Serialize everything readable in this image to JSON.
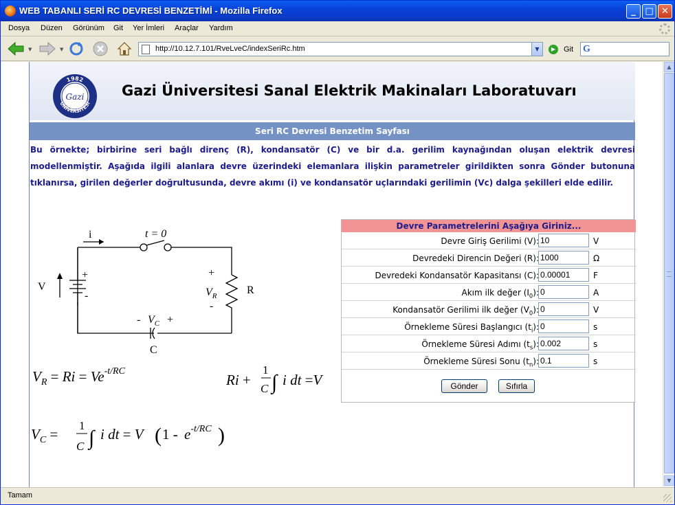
{
  "window": {
    "title": "WEB TABANLI SERİ RC DEVRESİ BENZETİMİ  -  Mozilla Firefox",
    "minimize": "_",
    "maximize": "□",
    "close": "✕"
  },
  "menu": [
    "Dosya",
    "Düzen",
    "Görünüm",
    "Git",
    "Yer İmleri",
    "Araçlar",
    "Yardım"
  ],
  "nav": {
    "url": "http://10.12.7.101/RveLveC/indexSeriRc.htm",
    "go_label": "Git",
    "search_engine": "G"
  },
  "status": {
    "text": "Tamam"
  },
  "page": {
    "logo_year": "1982",
    "logo_text": "ÜNİVERSİTESİ",
    "logo_initials": "Gazi",
    "site_title": "Gazi Üniversitesi Sanal Elektrik Makinaları Laboratuvarı",
    "subheading": "Seri RC Devresi Benzetim Sayfası",
    "intro": "Bu örnekte; birbirine seri bağlı direnç (R), kondansatör (C) ve bir d.a. gerilim kaynağından oluşan elektrik devresi modellenmiştir. Aşağıda ilgili alanlara devre üzerindeki elemanlara ilişkin parametreler girildikten sonra Gönder butonuna tıklanırsa, girilen değerler doğrultusunda, devre akımı (i) ve kondansatör uçlarındaki gerilimin (Vc) dalga şekilleri elde edilir."
  },
  "circuit": {
    "current": "i",
    "switch": "t = 0",
    "source": "V",
    "plus": "+",
    "minus": "-",
    "vr": "V",
    "vr_sub": "R",
    "resistor": "R",
    "vc": "V",
    "vc_sub": "C",
    "capacitor": "C"
  },
  "equations": {
    "eq1": "V_R = Ri = Ve^{-t/RC}",
    "eq2": "Ri + (1/C)∫ i dt = V",
    "eq3": "V_C = (1/C)∫ i dt = V(1 - e^{-t/RC})"
  },
  "form": {
    "header": "Devre Parametrelerini Aşağıya Giriniz...",
    "rows": [
      {
        "label": "Devre Giriş Gerilimi (V):",
        "value": "10",
        "unit": "V"
      },
      {
        "label": "Devredeki Direncin Değeri (R):",
        "value": "1000",
        "unit": "Ω"
      },
      {
        "label": "Devredeki Kondansatör Kapasitansı (C):",
        "value": "0.00001",
        "unit": "F"
      },
      {
        "label": "Akım ilk değer (I0):",
        "value": "0",
        "unit": "A"
      },
      {
        "label": "Kondansatör Gerilimi ilk değer (V0):",
        "value": "0",
        "unit": "V"
      },
      {
        "label": "Örnekleme Süresi Başlangıcı (ti):",
        "value": "0",
        "unit": "s"
      },
      {
        "label": "Örnekleme Süresi Adımı (ts):",
        "value": "0.002",
        "unit": "s"
      },
      {
        "label": "Örnekleme Süresi Sonu (tn):",
        "value": "0.1",
        "unit": "s"
      }
    ],
    "submit": "Gönder",
    "reset": "Sıfırla"
  }
}
